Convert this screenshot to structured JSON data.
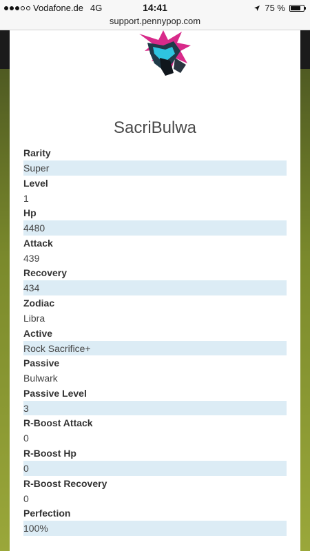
{
  "status_bar": {
    "carrier": "Vodafone.de",
    "network": "4G",
    "time": "14:41",
    "battery": "75 %",
    "battery_level": 0.75,
    "signal_bars_filled": 3,
    "signal_bars_total": 5,
    "location_icon": "location-arrow-icon"
  },
  "browser": {
    "url": "support.pennypop.com"
  },
  "monster": {
    "name": "SacriBulwa",
    "image": "monster-portrait",
    "stats": [
      {
        "label": "Rarity",
        "value": "Super"
      },
      {
        "label": "Level",
        "value": "1"
      },
      {
        "label": "Hp",
        "value": "4480"
      },
      {
        "label": "Attack",
        "value": "439"
      },
      {
        "label": "Recovery",
        "value": "434"
      },
      {
        "label": "Zodiac",
        "value": "Libra"
      },
      {
        "label": "Active",
        "value": "Rock Sacrifice+"
      },
      {
        "label": "Passive",
        "value": "Bulwark"
      },
      {
        "label": "Passive Level",
        "value": "3"
      },
      {
        "label": "R-Boost Attack",
        "value": "0"
      },
      {
        "label": "R-Boost Hp",
        "value": "0"
      },
      {
        "label": "R-Boost Recovery",
        "value": "0"
      },
      {
        "label": "Perfection",
        "value": "100%"
      }
    ]
  },
  "colors": {
    "highlight_row": "#dcecf5",
    "title_text": "#4a4a4a"
  }
}
